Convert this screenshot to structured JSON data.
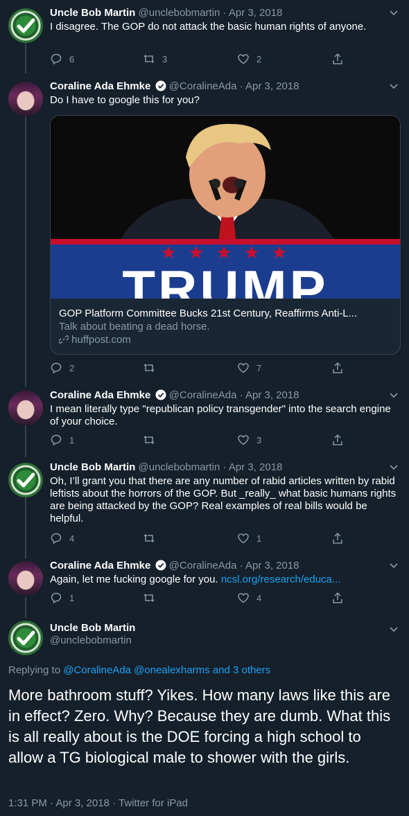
{
  "tweets": [
    {
      "name": "Uncle Bob Martin",
      "handle": "@unclebobmartin",
      "sep": "·",
      "date": "Apr 3, 2018",
      "text": "I disagree.  The GOP do not attack the basic human rights of anyone.",
      "replies": "6",
      "retweets": "3",
      "likes": "2"
    },
    {
      "name": "Coraline Ada Ehmke",
      "handle": "@CoralineAda",
      "sep": "·",
      "date": "Apr 3, 2018",
      "text": "Do I have to google this for you?",
      "card": {
        "image_text": "TRUMP",
        "title": "GOP Platform Committee Bucks 21st Century, Reaffirms Anti-L...",
        "description": "Talk about beating a dead horse.",
        "source": "huffpost.com"
      },
      "replies": "2",
      "retweets": "",
      "likes": "7"
    },
    {
      "name": "Coraline Ada Ehmke",
      "handle": "@CoralineAda",
      "sep": "·",
      "date": "Apr 3, 2018",
      "text": "I mean literally type \"republican policy transgender\" into the search engine of your choice.",
      "replies": "1",
      "retweets": "",
      "likes": "3"
    },
    {
      "name": "Uncle Bob Martin",
      "handle": "@unclebobmartin",
      "sep": "·",
      "date": "Apr 3, 2018",
      "text": "Oh, I’ll grant you that there are any number of rabid articles written by rabid leftists about the horrors of the GOP.  But _really_ what basic humans rights are being attacked by the GOP?  Real examples of real bills would be helpful.",
      "replies": "4",
      "retweets": "",
      "likes": "1"
    },
    {
      "name": "Coraline Ada Ehmke",
      "handle": "@CoralineAda",
      "sep": "·",
      "date": "Apr 3, 2018",
      "text": "Again, let me fucking google for you. ",
      "link": "ncsl.org/research/educa...",
      "replies": "1",
      "retweets": "",
      "likes": "4"
    }
  ],
  "main": {
    "name": "Uncle Bob Martin",
    "handle": "@unclebobmartin",
    "replying_prefix": "Replying to ",
    "replying_to": "@CoralineAda @onealexharms and 3 others",
    "text": "More bathroom stuff?  Yikes.  How many laws like this are in effect?  Zero.  Why?  Because they are dumb.   What this is all really about is the DOE forcing a high school to allow a TG biological male to shower with the girls.",
    "meta": "1:31 PM · Apr 3, 2018 · Twitter for iPad"
  },
  "colors": {
    "background": "#15202b",
    "text_secondary": "#8899a6",
    "link": "#1da1f2",
    "border": "#38444d"
  },
  "icons": [
    "reply-icon",
    "retweet-icon",
    "like-icon",
    "share-icon",
    "verified-icon",
    "chevron-down-icon",
    "link-icon"
  ]
}
